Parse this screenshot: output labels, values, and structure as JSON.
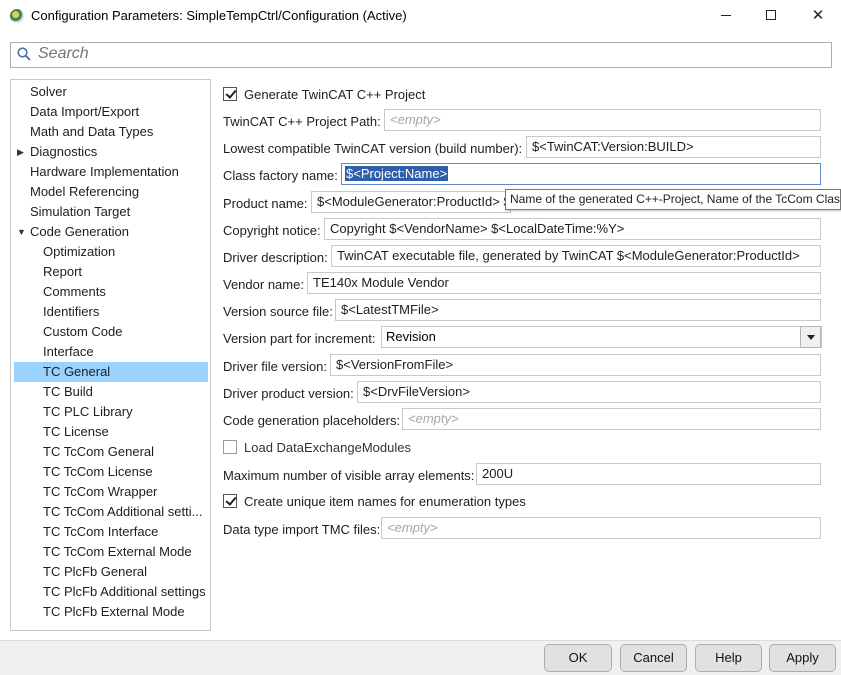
{
  "window": {
    "title": "Configuration Parameters: SimpleTempCtrl/Configuration (Active)",
    "controls": {
      "minimize": "—",
      "maximize": "☐",
      "close": "✕"
    }
  },
  "search": {
    "placeholder": "Search"
  },
  "tree": {
    "items": [
      {
        "label": "Solver",
        "level": 0
      },
      {
        "label": "Data Import/Export",
        "level": 0
      },
      {
        "label": "Math and Data Types",
        "level": 0
      },
      {
        "label": "Diagnostics",
        "level": 0,
        "expander": "▶"
      },
      {
        "label": "Hardware Implementation",
        "level": 0
      },
      {
        "label": "Model Referencing",
        "level": 0
      },
      {
        "label": "Simulation Target",
        "level": 0
      },
      {
        "label": "Code Generation",
        "level": 0,
        "expander": "▼"
      },
      {
        "label": "Optimization",
        "level": 1
      },
      {
        "label": "Report",
        "level": 1
      },
      {
        "label": "Comments",
        "level": 1
      },
      {
        "label": "Identifiers",
        "level": 1
      },
      {
        "label": "Custom Code",
        "level": 1
      },
      {
        "label": "Interface",
        "level": 1
      },
      {
        "label": "TC General",
        "level": 1,
        "selected": true
      },
      {
        "label": "TC Build",
        "level": 1
      },
      {
        "label": "TC PLC Library",
        "level": 1
      },
      {
        "label": "TC License",
        "level": 1
      },
      {
        "label": "TC TcCom General",
        "level": 1
      },
      {
        "label": "TC TcCom License",
        "level": 1
      },
      {
        "label": "TC TcCom Wrapper",
        "level": 1
      },
      {
        "label": "TC TcCom Additional setti...",
        "level": 1
      },
      {
        "label": "TC TcCom Interface",
        "level": 1
      },
      {
        "label": "TC TcCom External Mode",
        "level": 1
      },
      {
        "label": "TC PlcFb General",
        "level": 1
      },
      {
        "label": "TC PlcFb Additional settings",
        "level": 1
      },
      {
        "label": "TC PlcFb External Mode",
        "level": 1
      }
    ]
  },
  "form": {
    "generate_cpp": {
      "label": "Generate TwinCAT C++ Project",
      "checked": true
    },
    "project_path": {
      "label": "TwinCAT C++ Project Path:",
      "placeholder": "<empty>"
    },
    "lowest_version": {
      "label": "Lowest compatible TwinCAT version (build number):",
      "value": "$<TwinCAT:Version:BUILD>"
    },
    "class_factory": {
      "label": "Class factory name:",
      "value": "$<Project:Name>"
    },
    "product_name": {
      "label": "Product name:",
      "value": "$<ModuleGenerator:ProductId> $"
    },
    "tooltip": "Name of the generated C++-Project, Name of the TcCom Class",
    "copyright": {
      "label": "Copyright notice:",
      "value": "Copyright $<VendorName> $<LocalDateTime:%Y>"
    },
    "driver_description": {
      "label": "Driver description:",
      "value": "TwinCAT executable file, generated by TwinCAT $<ModuleGenerator:ProductId>"
    },
    "vendor_name": {
      "label": "Vendor name:",
      "value": "TE140x Module Vendor"
    },
    "version_source": {
      "label": "Version source file:",
      "value": "$<LatestTMFile>"
    },
    "version_part": {
      "label": "Version part for increment:",
      "value": "Revision"
    },
    "driver_file_version": {
      "label": "Driver file version:",
      "value": "$<VersionFromFile>"
    },
    "driver_product_version": {
      "label": "Driver product version:",
      "value": "$<DrvFileVersion>"
    },
    "placeholders": {
      "label": "Code generation placeholders:",
      "placeholder": "<empty>"
    },
    "load_modules": {
      "label": "Load DataExchangeModules",
      "checked": false
    },
    "max_array": {
      "label": "Maximum number of visible array elements:",
      "value": "200U"
    },
    "unique_names": {
      "label": "Create unique item names for enumeration types",
      "checked": true
    },
    "tmc_files": {
      "label": "Data type import TMC files:",
      "placeholder": "<empty>"
    }
  },
  "buttons": {
    "ok": "OK",
    "cancel": "Cancel",
    "help": "Help",
    "apply": "Apply"
  }
}
